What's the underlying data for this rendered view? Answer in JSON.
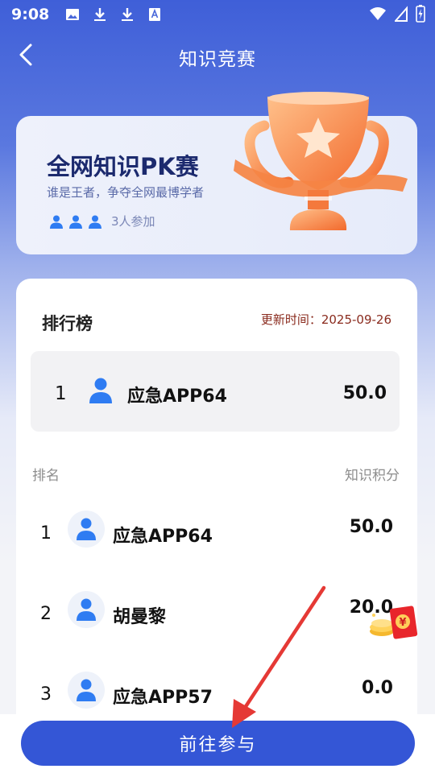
{
  "status_bar": {
    "time": "9:08"
  },
  "nav": {
    "title": "知识竞赛"
  },
  "banner": {
    "title": "全网知识PK赛",
    "subtitle": "谁是王者，争夺全网最博学者",
    "participants_text": "3人参加"
  },
  "leaderboard": {
    "title": "排行榜",
    "update_time": "更新时间：2025-09-26",
    "top": {
      "rank": "1",
      "name": "应急APP64",
      "score": "50.0"
    },
    "col_rank": "排名",
    "col_score": "知识积分",
    "rows": [
      {
        "rank": "1",
        "name": "应急APP64",
        "score": "50.0"
      },
      {
        "rank": "2",
        "name": "胡曼黎",
        "score": "20.0"
      },
      {
        "rank": "3",
        "name": "应急APP57",
        "score": "0.0"
      }
    ]
  },
  "action": {
    "join_label": "前往参与"
  },
  "red_packet": {
    "symbol": "¥"
  },
  "colors": {
    "primary": "#3456d6",
    "avatar_blue": "#2f7cf2",
    "update_time": "#8a2b1e",
    "annotation_arrow": "#e53935"
  }
}
